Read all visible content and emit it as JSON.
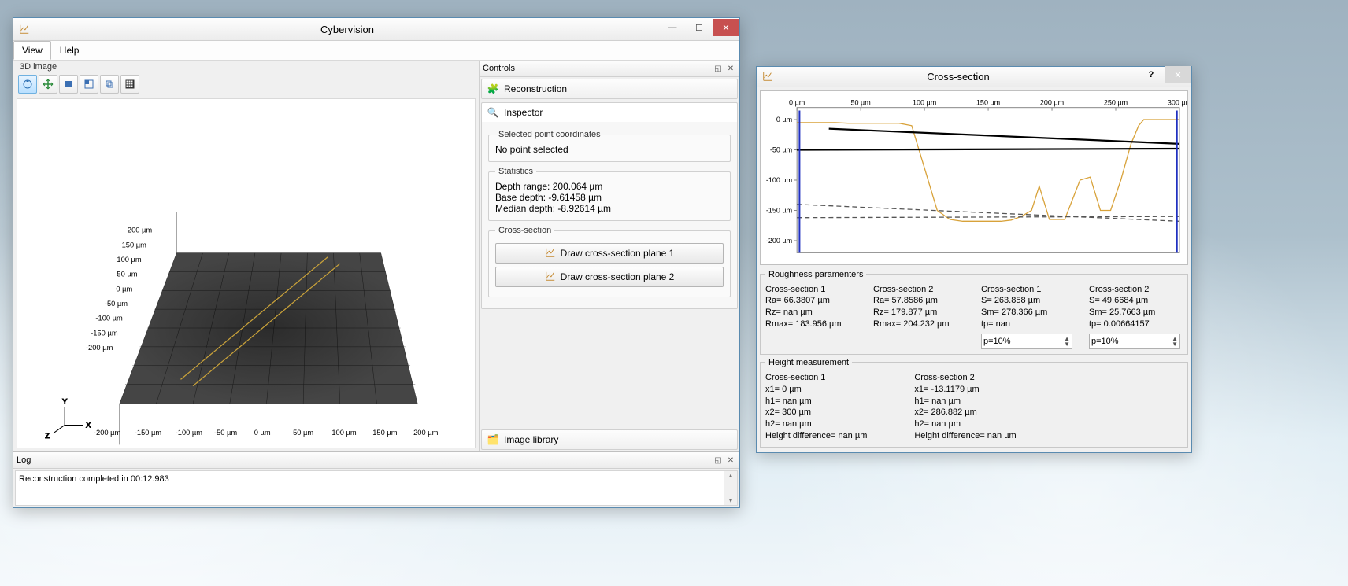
{
  "main_window": {
    "title": "Cybervision",
    "menubar": {
      "view": "View",
      "help": "Help"
    },
    "left_pane": {
      "title": "3D image"
    },
    "controls": {
      "title": "Controls",
      "reconstruction": "Reconstruction",
      "inspector": "Inspector",
      "image_library": "Image library",
      "selected_point": {
        "legend": "Selected point coordinates",
        "value": "No point selected"
      },
      "statistics": {
        "legend": "Statistics",
        "depth_range": "Depth range: 200.064 µm",
        "base_depth": "Base depth: -9.61458 µm",
        "median_depth": "Median depth: -8.92614 µm"
      },
      "cross_section": {
        "legend": "Cross-section",
        "btn1": "Draw cross-section plane 1",
        "btn2": "Draw cross-section plane 2"
      }
    },
    "log": {
      "title": "Log",
      "message": "Reconstruction completed in 00:12.983"
    },
    "axes3d": {
      "z_ticks": [
        "200 µm",
        "150 µm",
        "100 µm",
        "50 µm",
        "0 µm",
        "-50 µm",
        "-100 µm",
        "-150 µm",
        "-200 µm"
      ],
      "x_ticks": [
        "-200 µm",
        "-150 µm",
        "-100 µm",
        "-50 µm",
        "0 µm",
        "50 µm",
        "100 µm",
        "150 µm",
        "200 µm"
      ]
    }
  },
  "cross_window": {
    "title": "Cross-section",
    "roughness": {
      "legend": "Roughness paramenters",
      "c1a": {
        "title": "Cross-section 1",
        "ra": "Ra= 66.3807 µm",
        "rz": "Rz= nan µm",
        "rmax": "Rmax= 183.956 µm"
      },
      "c2a": {
        "title": "Cross-section 2",
        "ra": "Ra= 57.8586 µm",
        "rz": "Rz= 179.877 µm",
        "rmax": "Rmax= 204.232 µm"
      },
      "c1b": {
        "title": "Cross-section 1",
        "s": "S= 263.858 µm",
        "sm": "Sm= 278.366 µm",
        "tp": "tp= nan",
        "p": "p=10%"
      },
      "c2b": {
        "title": "Cross-section 2",
        "s": "S= 49.6684 µm",
        "sm": "Sm= 25.7663 µm",
        "tp": "tp= 0.00664157",
        "p": "p=10%"
      }
    },
    "height": {
      "legend": "Height measurement",
      "c1": {
        "title": "Cross-section 1",
        "x1": "x1= 0 µm",
        "h1": "h1= nan µm",
        "x2": "x2= 300 µm",
        "h2": "h2= nan µm",
        "diff": "Height difference= nan µm"
      },
      "c2": {
        "title": "Cross-section 2",
        "x1": "x1= -13.1179 µm",
        "h1": "h1= nan µm",
        "x2": "x2= 286.882 µm",
        "h2": "h2= nan µm",
        "diff": "Height difference= nan µm"
      }
    }
  },
  "chart_data": {
    "type": "line",
    "title": "Cross-section",
    "xlabel": "µm",
    "ylabel": "µm",
    "xlim": [
      0,
      300
    ],
    "ylim": [
      -220,
      20
    ],
    "x_ticks": [
      "0 µm",
      "50 µm",
      "100 µm",
      "150 µm",
      "200 µm",
      "250 µm",
      "300 µm"
    ],
    "y_ticks": [
      "0 µm",
      "-50 µm",
      "-100 µm",
      "-150 µm",
      "-200 µm"
    ],
    "series": [
      {
        "name": "profile",
        "color": "#d8a23a",
        "x": [
          0,
          10,
          20,
          30,
          40,
          80,
          90,
          100,
          110,
          120,
          130,
          140,
          150,
          160,
          168,
          176,
          184,
          190,
          198,
          210,
          222,
          230,
          238,
          246,
          254,
          262,
          268,
          272,
          276,
          280,
          290,
          300
        ],
        "y": [
          -5,
          -5,
          -5,
          -5,
          -6,
          -6,
          -10,
          -80,
          -150,
          -165,
          -168,
          -168,
          -168,
          -168,
          -166,
          -160,
          -150,
          -110,
          -165,
          -165,
          -100,
          -95,
          -150,
          -150,
          -100,
          -40,
          -10,
          0,
          0,
          0,
          0,
          0
        ]
      },
      {
        "name": "baseline-1",
        "color": "#000",
        "style": "solid",
        "x": [
          25,
          300
        ],
        "y": [
          -15,
          -40
        ]
      },
      {
        "name": "baseline-2",
        "color": "#000",
        "style": "solid",
        "x": [
          0,
          300
        ],
        "y": [
          -50,
          -48
        ]
      },
      {
        "name": "dash-1",
        "color": "#555",
        "style": "dash",
        "x": [
          0,
          300
        ],
        "y": [
          -140,
          -168
        ]
      },
      {
        "name": "dash-2",
        "color": "#555",
        "style": "dash",
        "x": [
          0,
          300
        ],
        "y": [
          -162,
          -160
        ]
      },
      {
        "name": "marker-left",
        "color": "#2030c0",
        "style": "solid",
        "x": [
          2,
          2
        ],
        "y": [
          15,
          -220
        ]
      },
      {
        "name": "marker-right",
        "color": "#2030c0",
        "style": "solid",
        "x": [
          298,
          298
        ],
        "y": [
          15,
          -220
        ]
      }
    ]
  }
}
